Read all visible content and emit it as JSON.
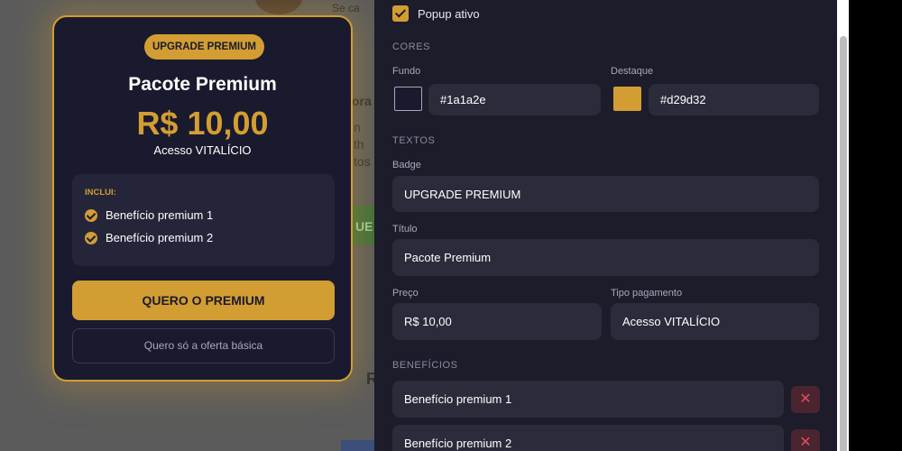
{
  "background_page": {
    "snippet_1": "Se ca",
    "snippet_2": "ora",
    "snippet_3": "n",
    "snippet_4": "th",
    "snippet_5": "tos",
    "snippet_6": "UE",
    "snippet_7": "R"
  },
  "popup_preview": {
    "badge": "UPGRADE PREMIUM",
    "title": "Pacote Premium",
    "price": "R$ 10,00",
    "access": "Acesso VITALÍCIO",
    "includes_label": "INCLUI:",
    "benefits": [
      "Benefício premium 1",
      "Benefício premium 2"
    ],
    "cta_primary": "QUERO O PREMIUM",
    "cta_secondary": "Quero só a oferta básica"
  },
  "settings": {
    "popup_active_label": "Popup ativo",
    "popup_active_checked": true,
    "colors_heading": "CORES",
    "background_label": "Fundo",
    "background_value": "#1a1a2e",
    "highlight_label": "Destaque",
    "highlight_value": "#d29d32",
    "texts_heading": "TEXTOS",
    "badge_label": "Badge",
    "badge_value": "UPGRADE PREMIUM",
    "title_label": "Título",
    "title_value": "Pacote Premium",
    "price_label": "Preço",
    "price_value": "R$ 10,00",
    "payment_type_label": "Tipo pagamento",
    "payment_type_value": "Acesso VITALÍCIO",
    "benefits_heading": "BENEFÍCIOS",
    "benefits": [
      "Benefício premium 1",
      "Benefício premium 2"
    ],
    "remove_icon": "close-icon"
  },
  "colors": {
    "accent": "#d29d32",
    "card_background": "#1a1a2e",
    "panel_background": "#1c1c2b",
    "input_background": "#2b2b3c",
    "danger": "#e24d5c"
  }
}
